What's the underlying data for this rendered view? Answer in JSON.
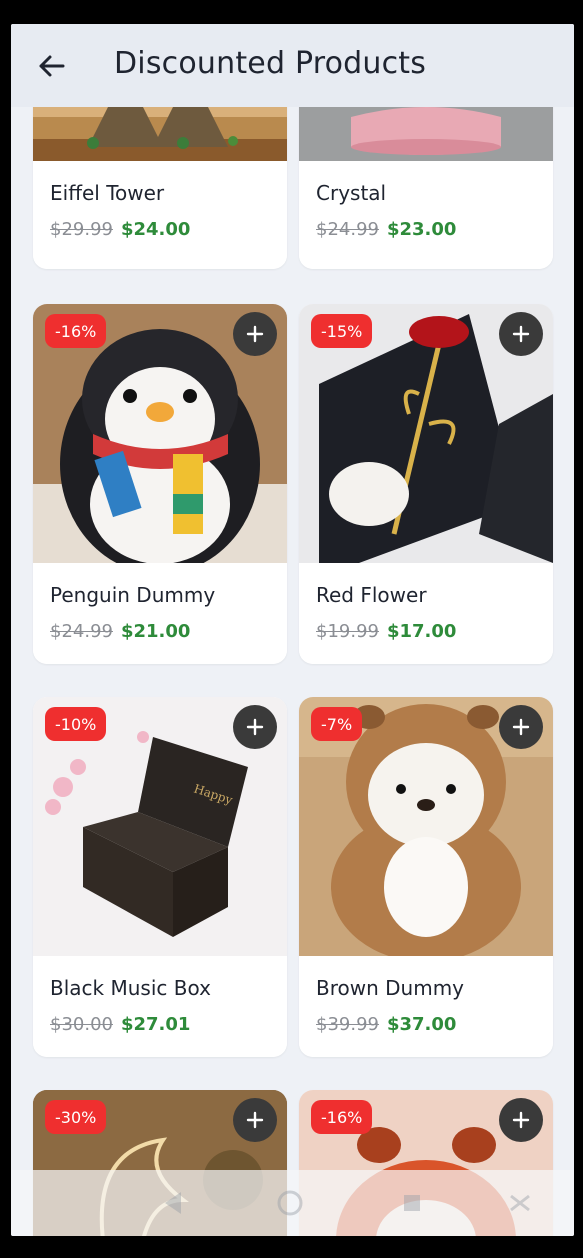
{
  "header": {
    "title": "Discounted Products",
    "back_icon": "arrow-left-icon"
  },
  "colors": {
    "price_new": "#2e8b3a",
    "badge": "#ef2f2f",
    "add_button": "#3a3a3a"
  },
  "products": [
    {
      "name": "Eiffel Tower",
      "old_price": "$29.99",
      "new_price": "$24.00",
      "discount": ""
    },
    {
      "name": "Crystal",
      "old_price": "$24.99",
      "new_price": "$23.00",
      "discount": ""
    },
    {
      "name": "Penguin Dummy",
      "old_price": "$24.99",
      "new_price": "$21.00",
      "discount": "-16%"
    },
    {
      "name": "Red Flower",
      "old_price": "$19.99",
      "new_price": "$17.00",
      "discount": "-15%"
    },
    {
      "name": "Black Music Box",
      "old_price": "$30.00",
      "new_price": "$27.01",
      "discount": "-10%"
    },
    {
      "name": "Brown Dummy",
      "old_price": "$39.99",
      "new_price": "$37.00",
      "discount": "-7%"
    },
    {
      "name": "",
      "old_price": "",
      "new_price": "",
      "discount": "-30%"
    },
    {
      "name": "",
      "old_price": "",
      "new_price": "",
      "discount": "-16%"
    }
  ],
  "navbar": {
    "icons": [
      "back-triangle-icon",
      "home-circle-icon",
      "recents-square-icon",
      "screenshot-icon"
    ]
  }
}
